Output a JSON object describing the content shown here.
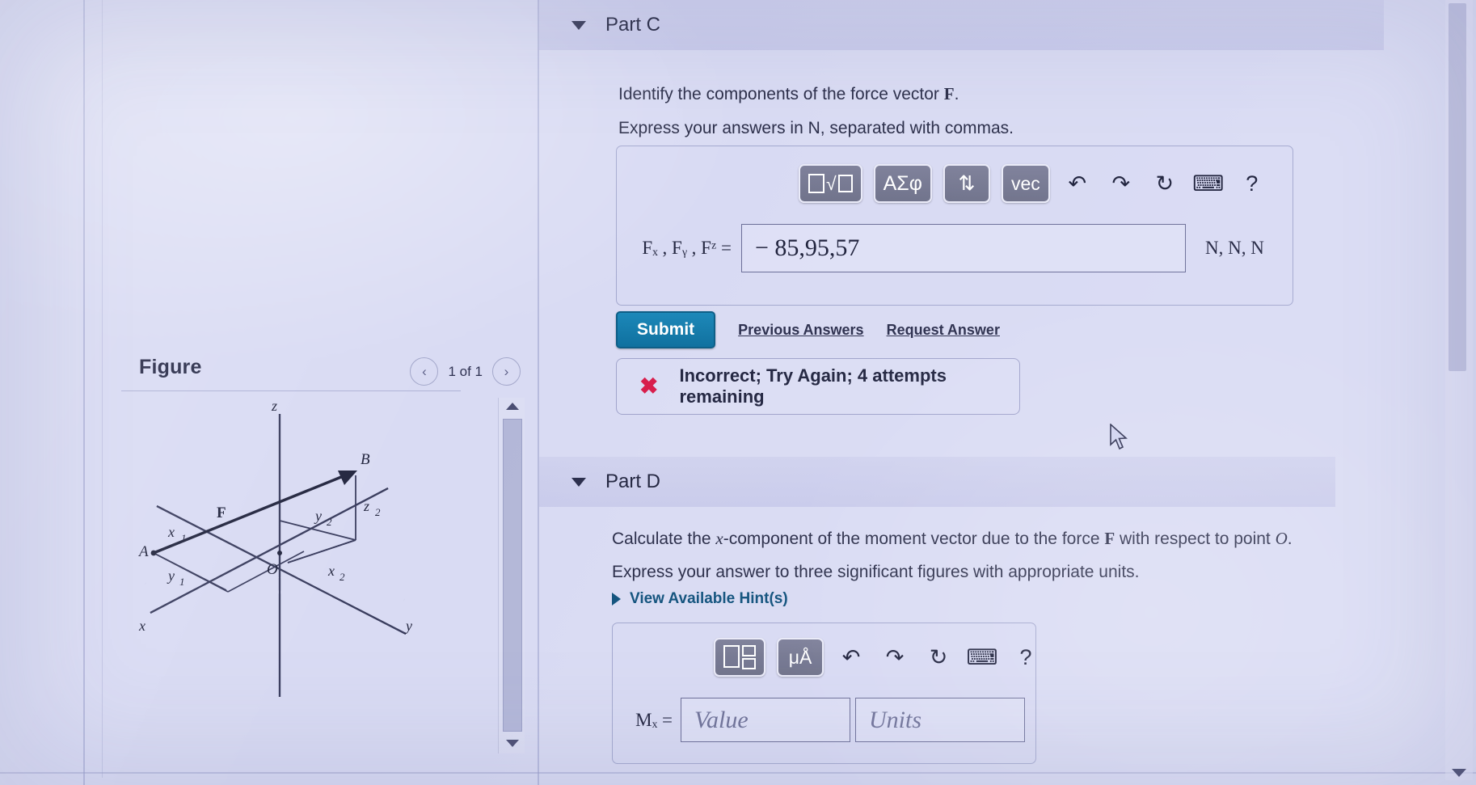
{
  "figure": {
    "title": "Figure",
    "pager": {
      "prev_icon": "chevron-left-icon",
      "label": "1 of 1",
      "next_icon": "chevron-right-icon"
    },
    "diagram": {
      "axis_labels": [
        "z",
        "x",
        "y"
      ],
      "point_labels": [
        "A",
        "B",
        "O"
      ],
      "vector_label": "F",
      "dimension_labels": [
        "x₁",
        "y₁",
        "z₂",
        "y₂",
        "x₂"
      ]
    }
  },
  "part_c": {
    "header": "Part C",
    "prompt_line1_a": "Identify the components of the force vector ",
    "prompt_line1_b": "F",
    "prompt_line1_c": ".",
    "prompt_line2": "Express your answers in N, separated with commas.",
    "toolbar": [
      {
        "name": "template-sqrt-key",
        "glyph": "□√□",
        "type": "key"
      },
      {
        "name": "greek-symbols-key",
        "glyph": "ΑΣφ",
        "type": "key"
      },
      {
        "name": "sub-superscript-key",
        "glyph": "⇅",
        "type": "key"
      },
      {
        "name": "vector-key",
        "glyph": "vec",
        "type": "key"
      },
      {
        "name": "undo-icon",
        "glyph": "↶",
        "type": "icon"
      },
      {
        "name": "redo-icon",
        "glyph": "↷",
        "type": "icon"
      },
      {
        "name": "reset-icon",
        "glyph": "↻",
        "type": "icon"
      },
      {
        "name": "keyboard-icon",
        "glyph": "⌨",
        "type": "icon"
      },
      {
        "name": "help-icon",
        "glyph": "?",
        "type": "icon"
      }
    ],
    "answer_label": "Fₓ , Fᵧ , Fᶻ =",
    "answer_value": "− 85,95,57",
    "answer_units": "N, N, N",
    "submit_label": "Submit",
    "previous_answers_label": "Previous Answers",
    "request_answer_label": "Request Answer",
    "feedback_icon": "✖",
    "feedback_text": "Incorrect; Try Again; 4 attempts remaining",
    "feedback_color": "#d81b4a"
  },
  "part_d": {
    "header": "Part D",
    "prompt_a": "Calculate the ",
    "prompt_x": "x",
    "prompt_b": "-component of the moment vector due to the force ",
    "prompt_f": "F",
    "prompt_c": " with respect to point ",
    "prompt_o": "O",
    "prompt_d": ".",
    "prompt_line2": "Express your answer to three significant figures with appropriate units.",
    "hints_label": "View Available Hint(s)",
    "toolbar": [
      {
        "name": "template-key",
        "glyph": "□□",
        "type": "key"
      },
      {
        "name": "units-key",
        "glyph": "μÅ",
        "type": "key"
      },
      {
        "name": "undo-icon",
        "glyph": "↶",
        "type": "icon"
      },
      {
        "name": "redo-icon",
        "glyph": "↷",
        "type": "icon"
      },
      {
        "name": "reset-icon",
        "glyph": "↻",
        "type": "icon"
      },
      {
        "name": "keyboard-icon",
        "glyph": "⌨",
        "type": "icon"
      },
      {
        "name": "help-icon",
        "glyph": "?",
        "type": "icon"
      }
    ],
    "answer_label": "Mₓ =",
    "value_placeholder": "Value",
    "units_placeholder": "Units"
  },
  "colors": {
    "page_background": "#d9dbf3",
    "accent_submit": "#0d6f9e",
    "link": "#11527c",
    "error": "#d81b4a",
    "text": "#22253f"
  }
}
